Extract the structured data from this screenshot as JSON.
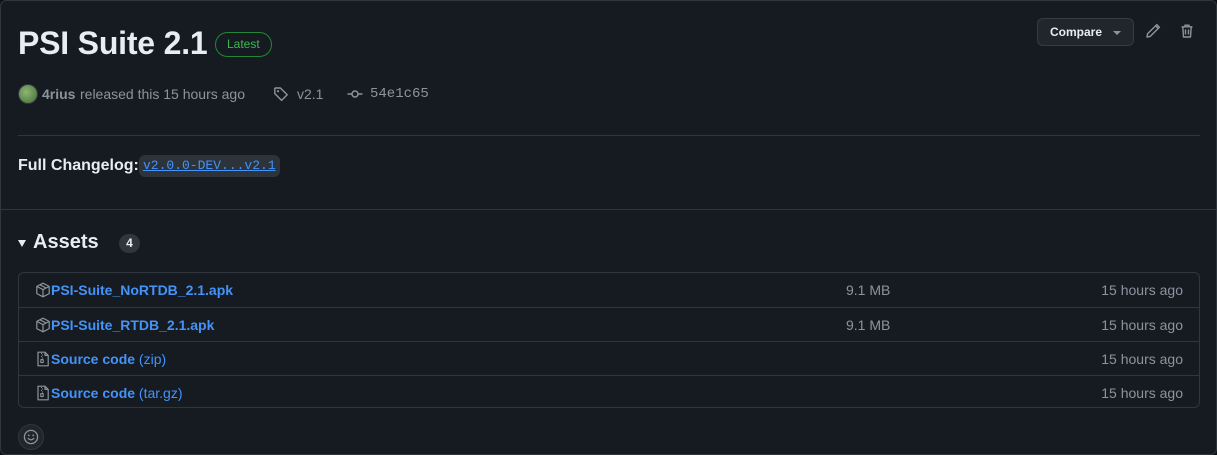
{
  "release": {
    "title": "PSI Suite 2.1",
    "badge": "Latest",
    "author": "4rius",
    "released_text": "released this 15 hours ago",
    "tag": "v2.1",
    "commit": "54e1c65"
  },
  "actions": {
    "compare_label": "Compare",
    "edit_icon": "pencil-icon",
    "delete_icon": "trash-icon"
  },
  "changelog": {
    "label": "Full Changelog:",
    "link": "v2.0.0-DEV...v2.1"
  },
  "assets": {
    "title": "Assets",
    "count": "4",
    "items": [
      {
        "icon": "package-icon",
        "name": "PSI-Suite_NoRTDB_2.1.apk",
        "suffix": "",
        "size": "9.1 MB",
        "time": "15 hours ago"
      },
      {
        "icon": "package-icon",
        "name": "PSI-Suite_RTDB_2.1.apk",
        "suffix": "",
        "size": "9.1 MB",
        "time": "15 hours ago"
      },
      {
        "icon": "file-zip-icon",
        "name": "Source code",
        "suffix": "(zip)",
        "size": "",
        "time": "15 hours ago"
      },
      {
        "icon": "file-zip-icon",
        "name": "Source code",
        "suffix": "(tar.gz)",
        "size": "",
        "time": "15 hours ago"
      }
    ]
  },
  "colors": {
    "background": "#161b22",
    "link": "#4493f8",
    "latest_badge": "#3fb950",
    "muted": "#8b949e"
  }
}
